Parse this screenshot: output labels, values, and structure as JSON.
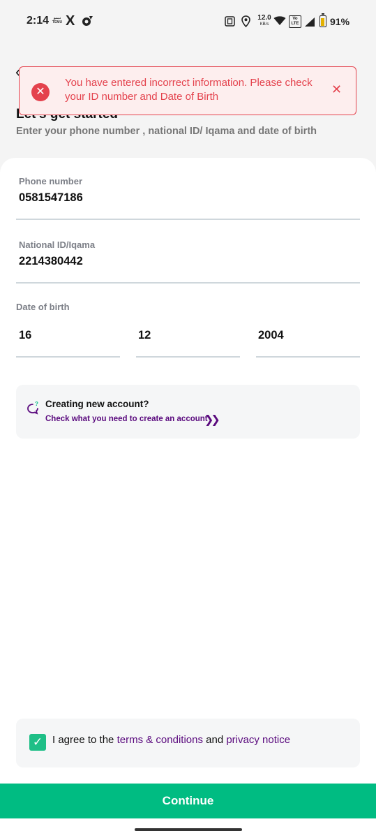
{
  "status_bar": {
    "time": "2:14",
    "temu_label": "ﺗﻴﻤﻮ TEMU",
    "x_icon": "X",
    "net_speed_value": "12.0",
    "net_speed_unit": "KB/s",
    "volte_label": "Vo LTE",
    "battery_percent": "91%",
    "battery_level": 0.91
  },
  "header": {
    "title": "Let's get started",
    "subtitle": "Enter your phone number , national ID/ Iqama and date of birth"
  },
  "error_toast": {
    "message": "You have entered incorrect information. Please check your ID number and Date of Birth",
    "color": "#e4424d"
  },
  "form": {
    "phone": {
      "label": "Phone number",
      "value": "0581547186"
    },
    "national_id": {
      "label": "National ID/Iqama",
      "value": "2214380442"
    },
    "dob": {
      "label": "Date of birth",
      "day": "16",
      "month": "12",
      "year": "2004"
    }
  },
  "new_account": {
    "title": "Creating new account?",
    "link": "Check what you need to create an account"
  },
  "agreement": {
    "prefix": "I agree to the ",
    "terms": "terms & conditions",
    "middle": " and ",
    "privacy": "privacy notice",
    "checked": true
  },
  "continue_label": "Continue",
  "colors": {
    "accent": "#00bc82",
    "link": "#5a0a7e",
    "error": "#e4424d"
  }
}
